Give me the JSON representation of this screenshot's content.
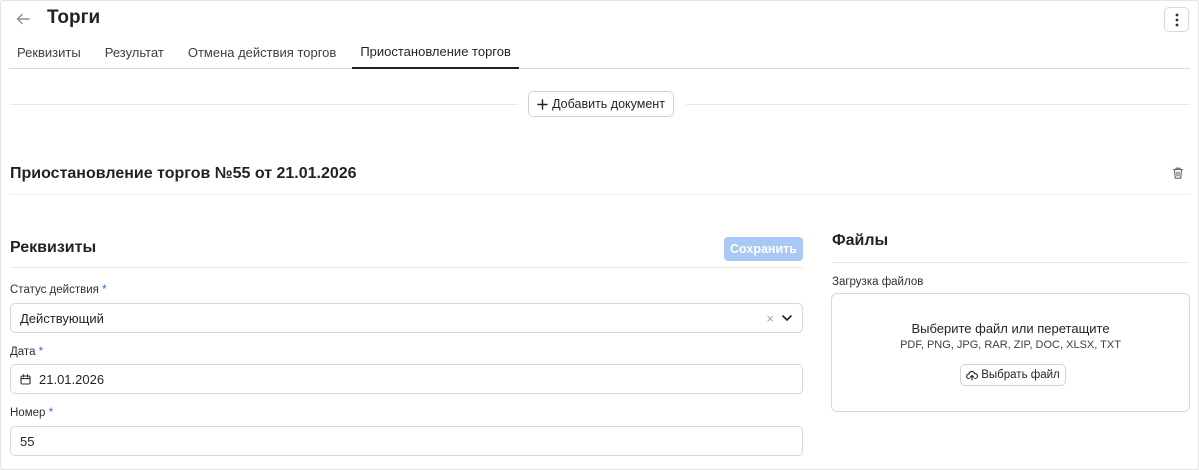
{
  "header": {
    "title": "Торги",
    "back_icon": "arrow-left-icon",
    "more_icon": "more-vertical-icon"
  },
  "tabs": [
    {
      "label": "Реквизиты",
      "active": false
    },
    {
      "label": "Результат",
      "active": false
    },
    {
      "label": "Отмена действия торгов",
      "active": false
    },
    {
      "label": "Приостановление торгов",
      "active": true
    }
  ],
  "add_document": {
    "label": "Добавить документ",
    "icon": "plus-icon"
  },
  "document": {
    "title": "Приостановление торгов №55 от 21.01.2026",
    "delete_icon": "trash-icon"
  },
  "requisites": {
    "title": "Реквизиты",
    "save_label": "Сохранить",
    "fields": {
      "status": {
        "label": "Статус действия",
        "required_mark": "*",
        "value": "Действующий"
      },
      "date": {
        "label": "Дата",
        "required_mark": "*",
        "value": "21.01.2026"
      },
      "number": {
        "label": "Номер",
        "required_mark": "*",
        "value": "55"
      }
    }
  },
  "files": {
    "title": "Файлы",
    "upload_label": "Загрузка файлов",
    "dropzone_title": "Выберите файл или перетащите",
    "dropzone_types": "PDF, PNG, JPG, RAR, ZIP, DOC, XLSX, TXT",
    "choose_label": "Выбрать файл"
  },
  "colors": {
    "accent": "#2f6fd6",
    "save_disabled": "#a9c8f3",
    "border": "#d4d7dc"
  }
}
